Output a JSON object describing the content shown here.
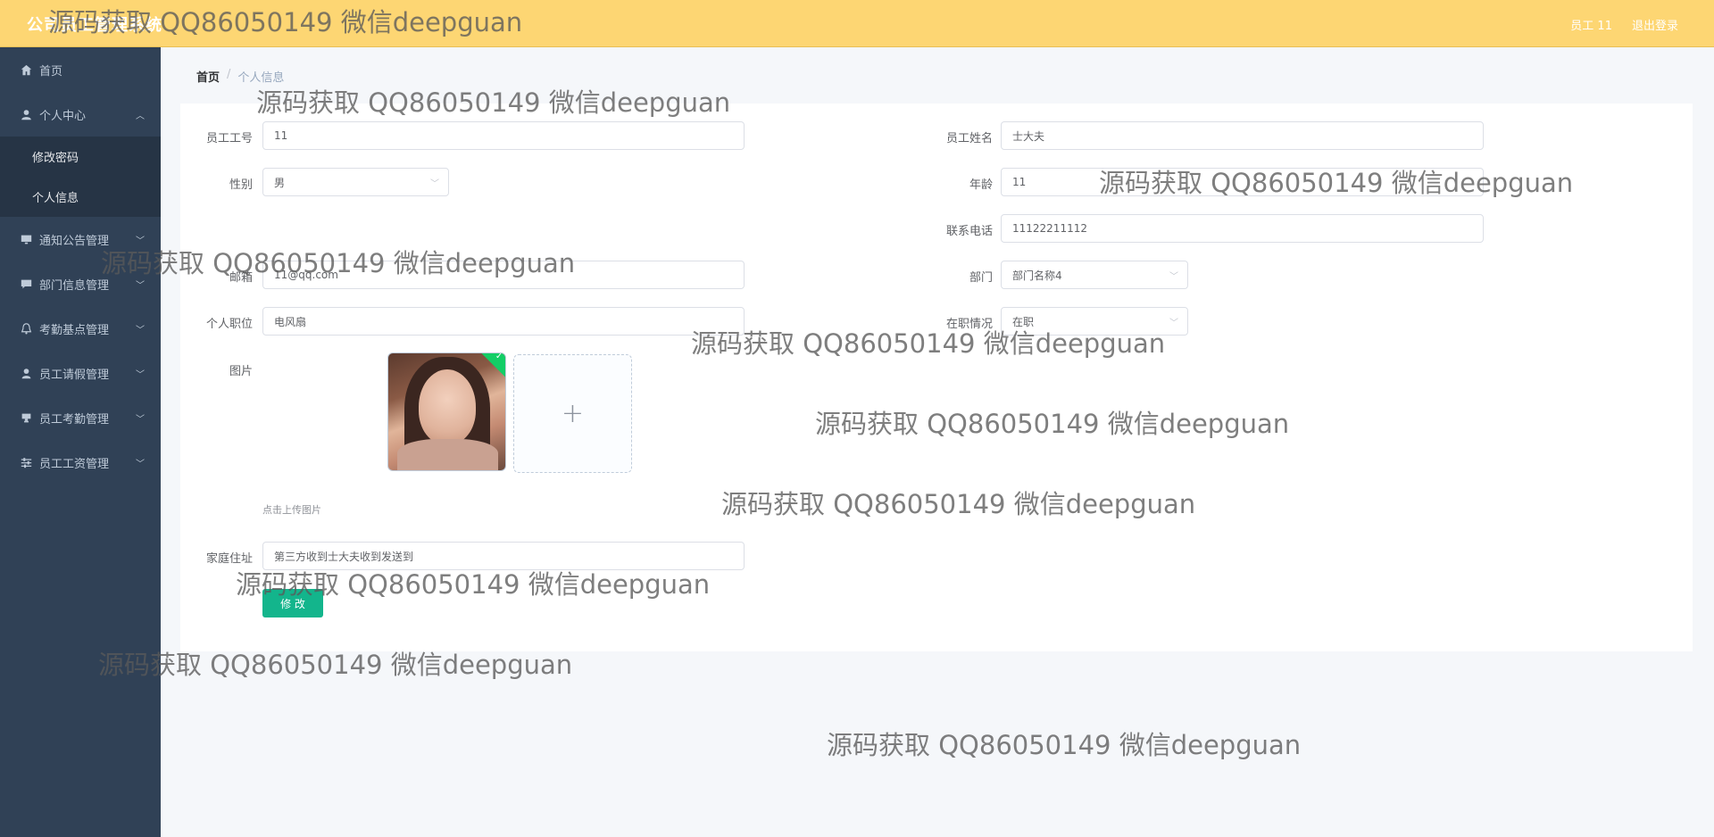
{
  "header": {
    "title": "公司员工管理系统",
    "user_label": "员工 11",
    "logout_label": "退出登录"
  },
  "sidebar": {
    "items": [
      {
        "label": "首页",
        "icon": "home-icon",
        "has_arrow": false
      },
      {
        "label": "个人中心",
        "icon": "user-icon",
        "has_arrow": true,
        "expanded": true
      },
      {
        "label": "通知公告管理",
        "icon": "monitor-icon",
        "has_arrow": true
      },
      {
        "label": "部门信息管理",
        "icon": "chat-icon",
        "has_arrow": true
      },
      {
        "label": "考勤基点管理",
        "icon": "bell-icon",
        "has_arrow": true
      },
      {
        "label": "员工请假管理",
        "icon": "person-icon",
        "has_arrow": true
      },
      {
        "label": "员工考勤管理",
        "icon": "stamp-icon",
        "has_arrow": true
      },
      {
        "label": "员工工资管理",
        "icon": "sliders-icon",
        "has_arrow": true
      }
    ],
    "submenu": [
      {
        "label": "修改密码"
      },
      {
        "label": "个人信息"
      }
    ]
  },
  "breadcrumb": {
    "home": "首页",
    "separator": "/",
    "current": "个人信息"
  },
  "form": {
    "employee_no_label": "员工工号",
    "employee_no_value": "11",
    "employee_name_label": "员工姓名",
    "employee_name_value": "士大夫",
    "gender_label": "性别",
    "gender_value": "男",
    "age_label": "年龄",
    "age_value": "11",
    "phone_label": "联系电话",
    "phone_value": "11122211112",
    "email_label": "邮箱",
    "email_value": "11@qq.com",
    "department_label": "部门",
    "department_value": "部门名称4",
    "position_label": "个人职位",
    "position_value": "电风扇",
    "status_label": "在职情况",
    "status_value": "在职",
    "photo_label": "图片",
    "upload_tip": "点击上传图片",
    "address_label": "家庭住址",
    "address_value": "第三方收到士大夫收到发送到",
    "submit_label": "修 改"
  },
  "watermark": "源码获取 QQ86050149 微信deepguan",
  "colors": {
    "header_bg": "#fdd673",
    "sidebar_bg": "#304156",
    "submit_bg": "#13b58c",
    "page_bg": "#f5f7fa"
  }
}
